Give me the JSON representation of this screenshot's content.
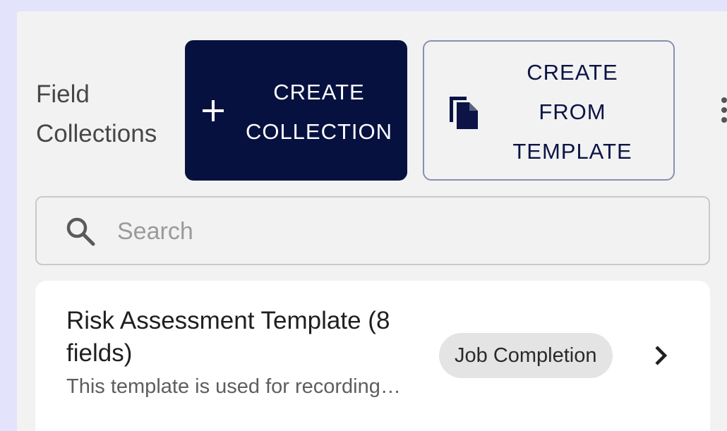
{
  "header": {
    "title": "Field Collections",
    "create_collection_label": "CREATE COLLECTION",
    "create_from_template_label": "CREATE FROM TEMPLATE"
  },
  "search": {
    "placeholder": "Search",
    "value": ""
  },
  "collections": [
    {
      "title": "Risk Assessment Template (8 fields)",
      "description": "This template is used for recording…",
      "tag": "Job Completion"
    }
  ],
  "colors": {
    "primary": "#06113f",
    "background": "#e3e3fb",
    "panel": "#f2f2f2",
    "chip": "#e4e4e4"
  },
  "icons": [
    "plus-icon",
    "copy-icon",
    "more-vert-icon",
    "search-icon",
    "chevron-right-icon"
  ]
}
